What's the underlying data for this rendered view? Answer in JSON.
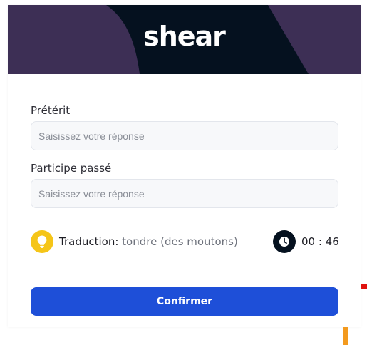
{
  "header": {
    "word": "shear",
    "colors": {
      "banner": "#05111f",
      "accent_shape": "#3d2f55"
    }
  },
  "fields": [
    {
      "label": "Prétérit",
      "placeholder": "Saisissez votre réponse",
      "value": ""
    },
    {
      "label": "Participe passé",
      "placeholder": "Saisissez votre réponse",
      "value": ""
    }
  ],
  "hint": {
    "icon": "lightbulb-icon",
    "label": "Traduction:",
    "value": "tondre (des moutons)",
    "color": "#f5c518"
  },
  "timer": {
    "icon": "clock-icon",
    "value": "00 : 46"
  },
  "confirm": {
    "label": "Confirmer",
    "color": "#1e4fd8"
  }
}
